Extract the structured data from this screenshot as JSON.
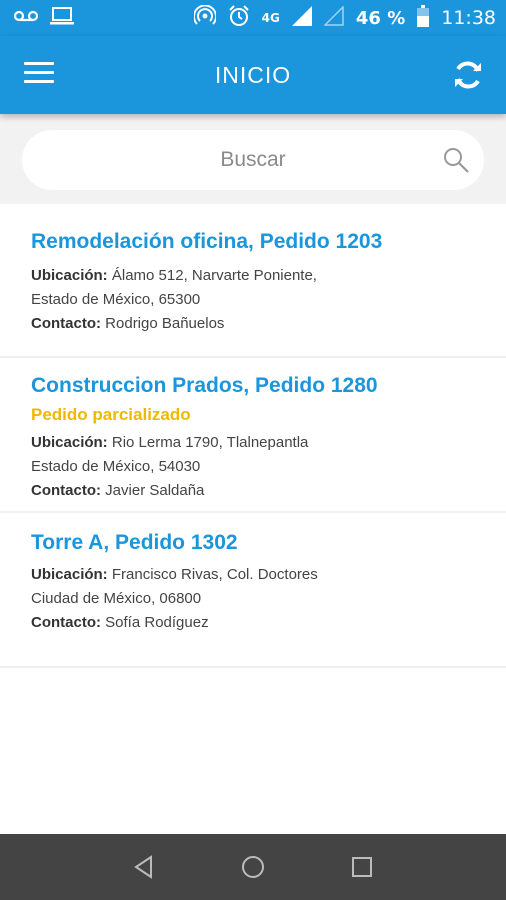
{
  "status_bar": {
    "network": "4G",
    "battery": "46 %",
    "time": "11:38"
  },
  "app_bar": {
    "title": "INICIO"
  },
  "search": {
    "placeholder": "Buscar"
  },
  "orders": [
    {
      "title": "Remodelación oficina, Pedido 1203",
      "status": "",
      "location_label": "Ubicación:",
      "location_line1": "Álamo 512, Narvarte Poniente,",
      "location_line2": "Estado de México, 65300",
      "contact_label": "Contacto:",
      "contact": "Rodrigo Bañuelos"
    },
    {
      "title": "Construccion Prados, Pedido 1280",
      "status": "Pedido parcializado",
      "location_label": "Ubicación:",
      "location_line1": "Rio Lerma 1790, Tlalnepantla",
      "location_line2": "Estado de México, 54030",
      "contact_label": "Contacto:",
      "contact": "Javier Saldaña"
    },
    {
      "title": "Torre A, Pedido 1302",
      "status": "",
      "location_label": "Ubicación:",
      "location_line1": "Francisco Rivas, Col. Doctores",
      "location_line2": "Ciudad de México, 06800",
      "contact_label": "Contacto:",
      "contact": "Sofía Rodíguez"
    }
  ],
  "colors": {
    "primary": "#1b95dc",
    "status_warning": "#f0b800",
    "nav_bar": "#444444"
  }
}
